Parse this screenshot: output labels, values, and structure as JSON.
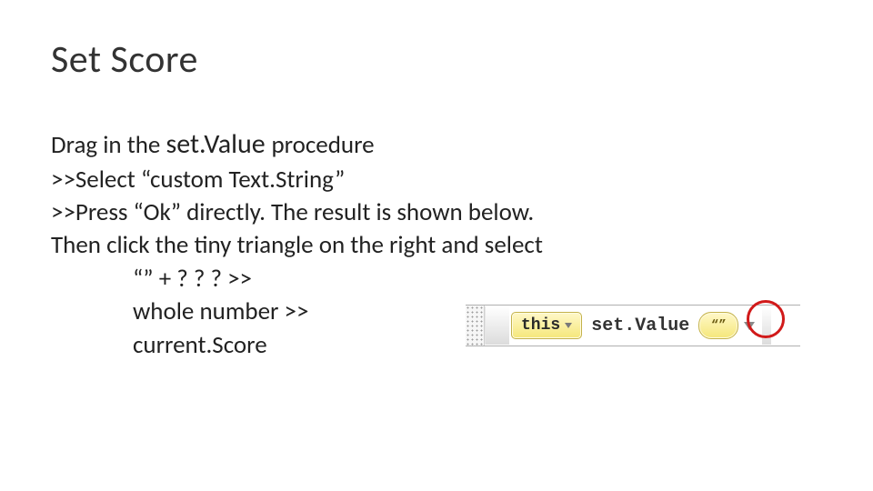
{
  "title": "Set Score",
  "body": {
    "line1_pre": "Drag in the ",
    "line1_big": "set.Value ",
    "line1_post": "procedure",
    "line2": ">>Select “custom Text.String”",
    "line3": ">>Press “Ok” directly. The result is shown below.",
    "line4": "Then click the tiny triangle on the right and select",
    "indent1": "“” + ? ? ? >>",
    "indent2": "whole number >>",
    "indent3": "current.Score"
  },
  "block": {
    "this_label": "this",
    "method_label": "set.Value",
    "value_literal": "“”"
  }
}
